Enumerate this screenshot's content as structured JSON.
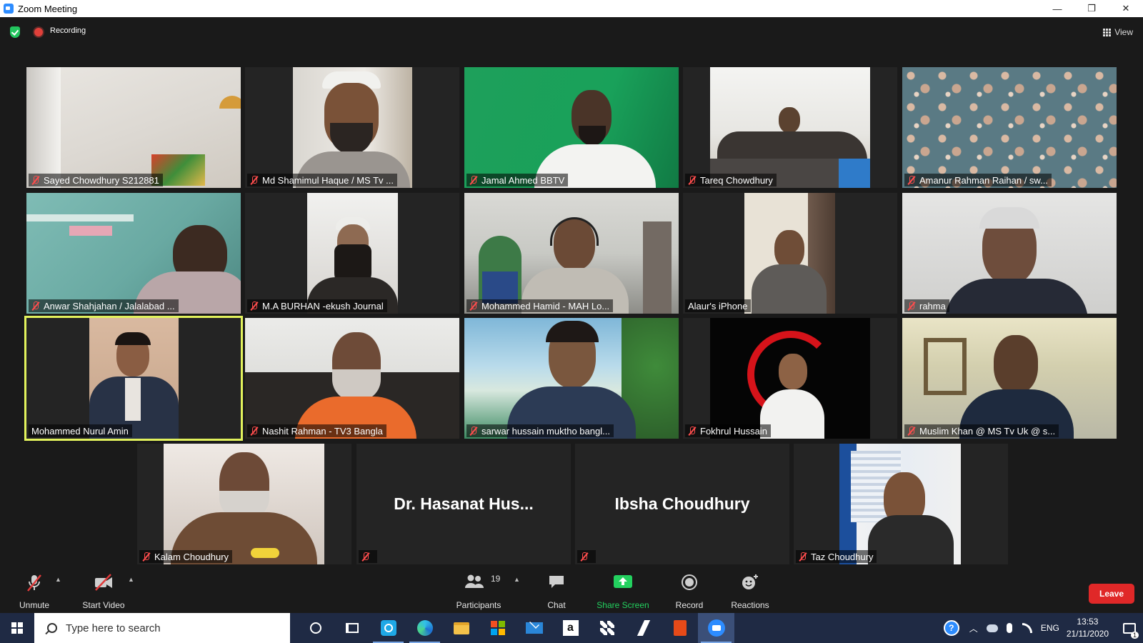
{
  "window": {
    "title": "Zoom Meeting",
    "minimize": "—",
    "restore": "❐",
    "close": "✕"
  },
  "topbar": {
    "recording_label": "Recording",
    "view_label": "View"
  },
  "participants": [
    {
      "name": "Sayed Chowdhury S212881",
      "muted": true
    },
    {
      "name": "Md Shamimul Haque / MS Tv ...",
      "muted": true
    },
    {
      "name": "Jamal Ahmed BBTV",
      "muted": true
    },
    {
      "name": "Tareq Chowdhury",
      "muted": true
    },
    {
      "name": "Amanur Rahman Raihan / sw...",
      "muted": true
    },
    {
      "name": "Anwar Shahjahan / Jalalabad ...",
      "muted": true
    },
    {
      "name": "M.A BURHAN -ekush Journal",
      "muted": true
    },
    {
      "name": "Mohammed Hamid - MAH Lo...",
      "muted": true
    },
    {
      "name": "Alaur's iPhone",
      "muted": false
    },
    {
      "name": "rahma",
      "muted": true
    },
    {
      "name": "Mohammed Nurul Amin",
      "muted": false,
      "active_speaker": true
    },
    {
      "name": "Nashit Rahman - TV3 Bangla",
      "muted": true
    },
    {
      "name": "sarwar hussain muktho bangl...",
      "muted": true
    },
    {
      "name": "Fokhrul Hussain",
      "muted": true
    },
    {
      "name": "Muslim Khan @ MS Tv Uk @ s...",
      "muted": true
    },
    {
      "name": "Kalam Choudhury",
      "muted": true
    },
    {
      "name": "Dr. Hasanat Hus...",
      "muted": true,
      "video_off": true
    },
    {
      "name": "Ibsha Choudhury",
      "muted": true,
      "video_off": true
    },
    {
      "name": "Taz Choudhury",
      "muted": true
    }
  ],
  "toolbar": {
    "unmute": "Unmute",
    "start_video": "Start Video",
    "participants": "Participants",
    "participant_count": "19",
    "chat": "Chat",
    "share_screen": "Share Screen",
    "record": "Record",
    "reactions": "Reactions",
    "leave": "Leave"
  },
  "taskbar": {
    "search_placeholder": "Type here to search",
    "language": "ENG",
    "time": "13:53",
    "date": "21/11/2020",
    "notification_count": "1"
  },
  "colors": {
    "share_screen_green": "#23d15f",
    "leave_red": "#e02828",
    "active_speaker_border": "#e2f25c",
    "mute_red": "#ff4d4d"
  }
}
